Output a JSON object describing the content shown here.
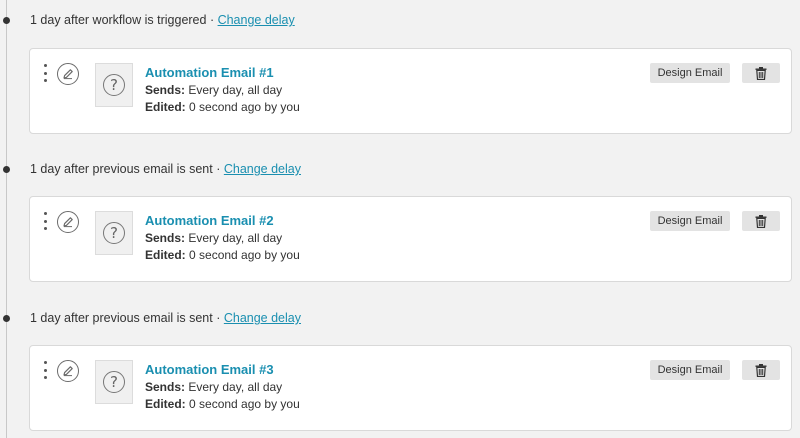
{
  "workflow": {
    "steps": [
      {
        "delay": {
          "text": "1 day after workflow is triggered · ",
          "link": "Change delay"
        },
        "email": {
          "title": "Automation Email #1",
          "sends_label": "Sends:",
          "sends_value": " Every day, all day",
          "edited_label": "Edited:",
          "edited_value": " 0 second ago by you",
          "design_label": "Design Email"
        }
      },
      {
        "delay": {
          "text": "1 day after previous email is sent · ",
          "link": "Change delay"
        },
        "email": {
          "title": "Automation Email #2",
          "sends_label": "Sends:",
          "sends_value": " Every day, all day",
          "edited_label": "Edited:",
          "edited_value": " 0 second ago by you",
          "design_label": "Design Email"
        }
      },
      {
        "delay": {
          "text": "1 day after previous email is sent · ",
          "link": "Change delay"
        },
        "email": {
          "title": "Automation Email #3",
          "sends_label": "Sends:",
          "sends_value": " Every day, all day",
          "edited_label": "Edited:",
          "edited_value": " 0 second ago by you",
          "design_label": "Design Email"
        }
      }
    ]
  },
  "icons": {
    "drag_handle": "kebab-icon",
    "edit": "pencil-icon",
    "thumbnail": "question-mark-icon",
    "delete": "trash-icon"
  },
  "colors": {
    "link": "#1a8fb0",
    "background": "#f2f2f2",
    "card": "#ffffff",
    "button": "#e3e3e3"
  }
}
